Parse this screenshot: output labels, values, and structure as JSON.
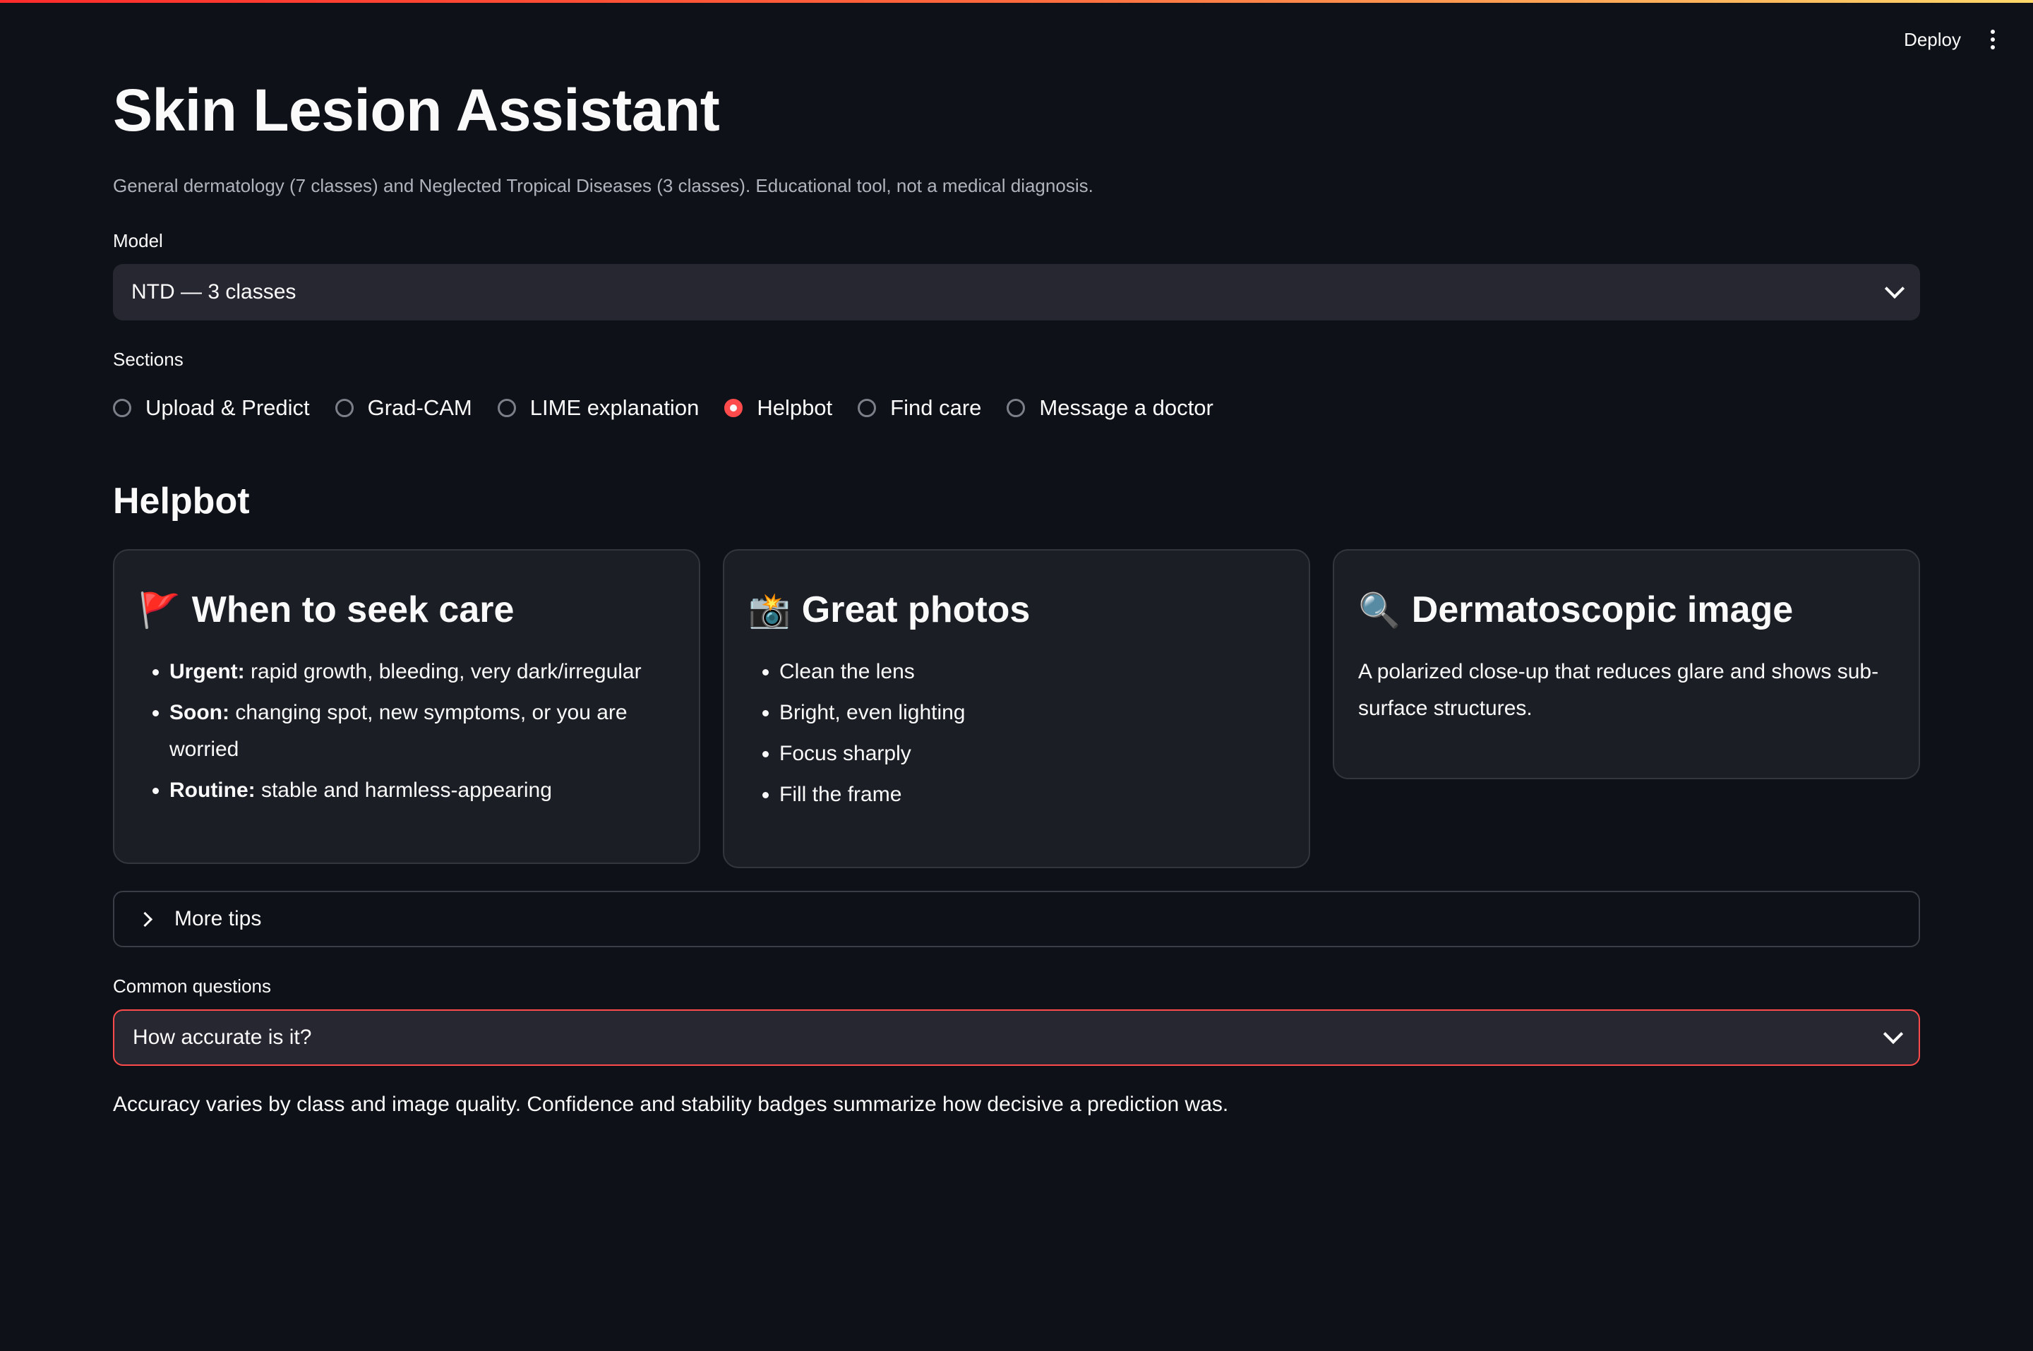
{
  "header": {
    "deploy_label": "Deploy",
    "menu_icon": "kebab-menu-icon"
  },
  "page": {
    "title": "Skin Lesion Assistant",
    "subtitle": "General dermatology (7 classes) and Neglected Tropical Diseases (3 classes). Educational tool, not a medical diagnosis."
  },
  "model": {
    "label": "Model",
    "selected": "NTD — 3 classes"
  },
  "sections": {
    "label": "Sections",
    "options": [
      "Upload & Predict",
      "Grad-CAM",
      "LIME explanation",
      "Helpbot",
      "Find care",
      "Message a doctor"
    ],
    "selected": "Helpbot"
  },
  "helpbot": {
    "heading": "Helpbot",
    "cards": [
      {
        "icon": "red-flag-icon",
        "emoji": "🚩",
        "title": "When to seek care",
        "items": [
          {
            "bold": "Urgent:",
            "text": " rapid growth, bleeding, very dark/irregular"
          },
          {
            "bold": "Soon:",
            "text": " changing spot, new symptoms, or you are worried"
          },
          {
            "bold": "Routine:",
            "text": " stable and harmless-appearing"
          }
        ]
      },
      {
        "icon": "camera-flash-icon",
        "emoji": "📸",
        "title": "Great photos",
        "items": [
          "Clean the lens",
          "Bright, even lighting",
          "Focus sharply",
          "Fill the frame"
        ]
      },
      {
        "icon": "magnifier-icon",
        "emoji": "🔍",
        "title": "Dermatoscopic image",
        "text": "A polarized close-up that reduces glare and shows sub-surface structures."
      }
    ],
    "more_tips": "More tips"
  },
  "questions": {
    "label": "Common questions",
    "selected": "How accurate is it?",
    "answer": "Accuracy varies by class and image quality. Confidence and stability badges summarize how decisive a prediction was."
  },
  "colors": {
    "background": "#0e1117",
    "accent": "#ff4b4b",
    "input_bg": "#262730",
    "card_bg": "#1b1e25"
  }
}
